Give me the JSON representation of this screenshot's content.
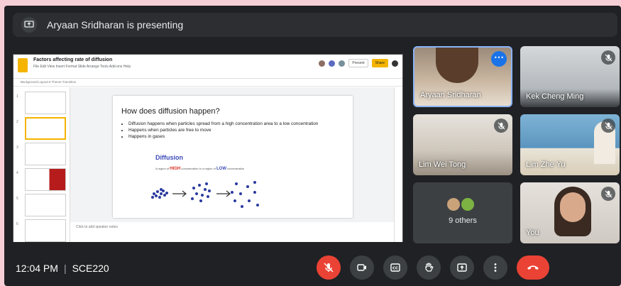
{
  "presenter_banner": {
    "text": "Aryaan Sridharan is presenting",
    "icon": "present-screen-icon"
  },
  "slides_app": {
    "doc_title": "Factors affecting rate of diffusion",
    "menu_items": "File  Edit  View  Insert  Format  Slide  Arrange  Tools  Add-ons  Help",
    "present_label": "Present",
    "share_label": "Share",
    "toolbar_text": "Background   Layout ▾   Theme   Transition",
    "speaker_notes": "Click to add speaker notes",
    "slide_numbers": [
      "1",
      "2",
      "3",
      "4",
      "5",
      "6"
    ]
  },
  "slide": {
    "heading": "How does diffusion happen?",
    "bullets": [
      "Diffusion happens when particles spread from a high concentration area to a low concentration",
      "Happens when particles are free to move",
      "Happens in gases"
    ],
    "diagram_title": "Diffusion",
    "line_before_high": "A region of",
    "high": "HIGH",
    "line_middle": "concentration to a region of",
    "low": "LOW",
    "line_after_low": "concentration"
  },
  "participants": [
    {
      "name": "Aryaan Sridharan",
      "active": true
    },
    {
      "name": "Kek Cheng Ming",
      "muted": true
    },
    {
      "name": "Lim Wei Tong",
      "muted": true
    },
    {
      "name": "Lim Zhe Yu",
      "muted": true
    },
    {
      "name": "You",
      "muted": true
    }
  ],
  "others_tile": {
    "label": "9 others"
  },
  "bottom_bar": {
    "time": "12:04 PM",
    "meeting_code": "SCE220",
    "controls": [
      "mic-off-icon",
      "camera-icon",
      "captions-icon",
      "raise-hand-icon",
      "present-screen-icon",
      "more-options-icon",
      "end-call-icon"
    ]
  },
  "colors": {
    "accent": "#1a73e8",
    "end_call": "#ea4335",
    "background": "#202124"
  }
}
